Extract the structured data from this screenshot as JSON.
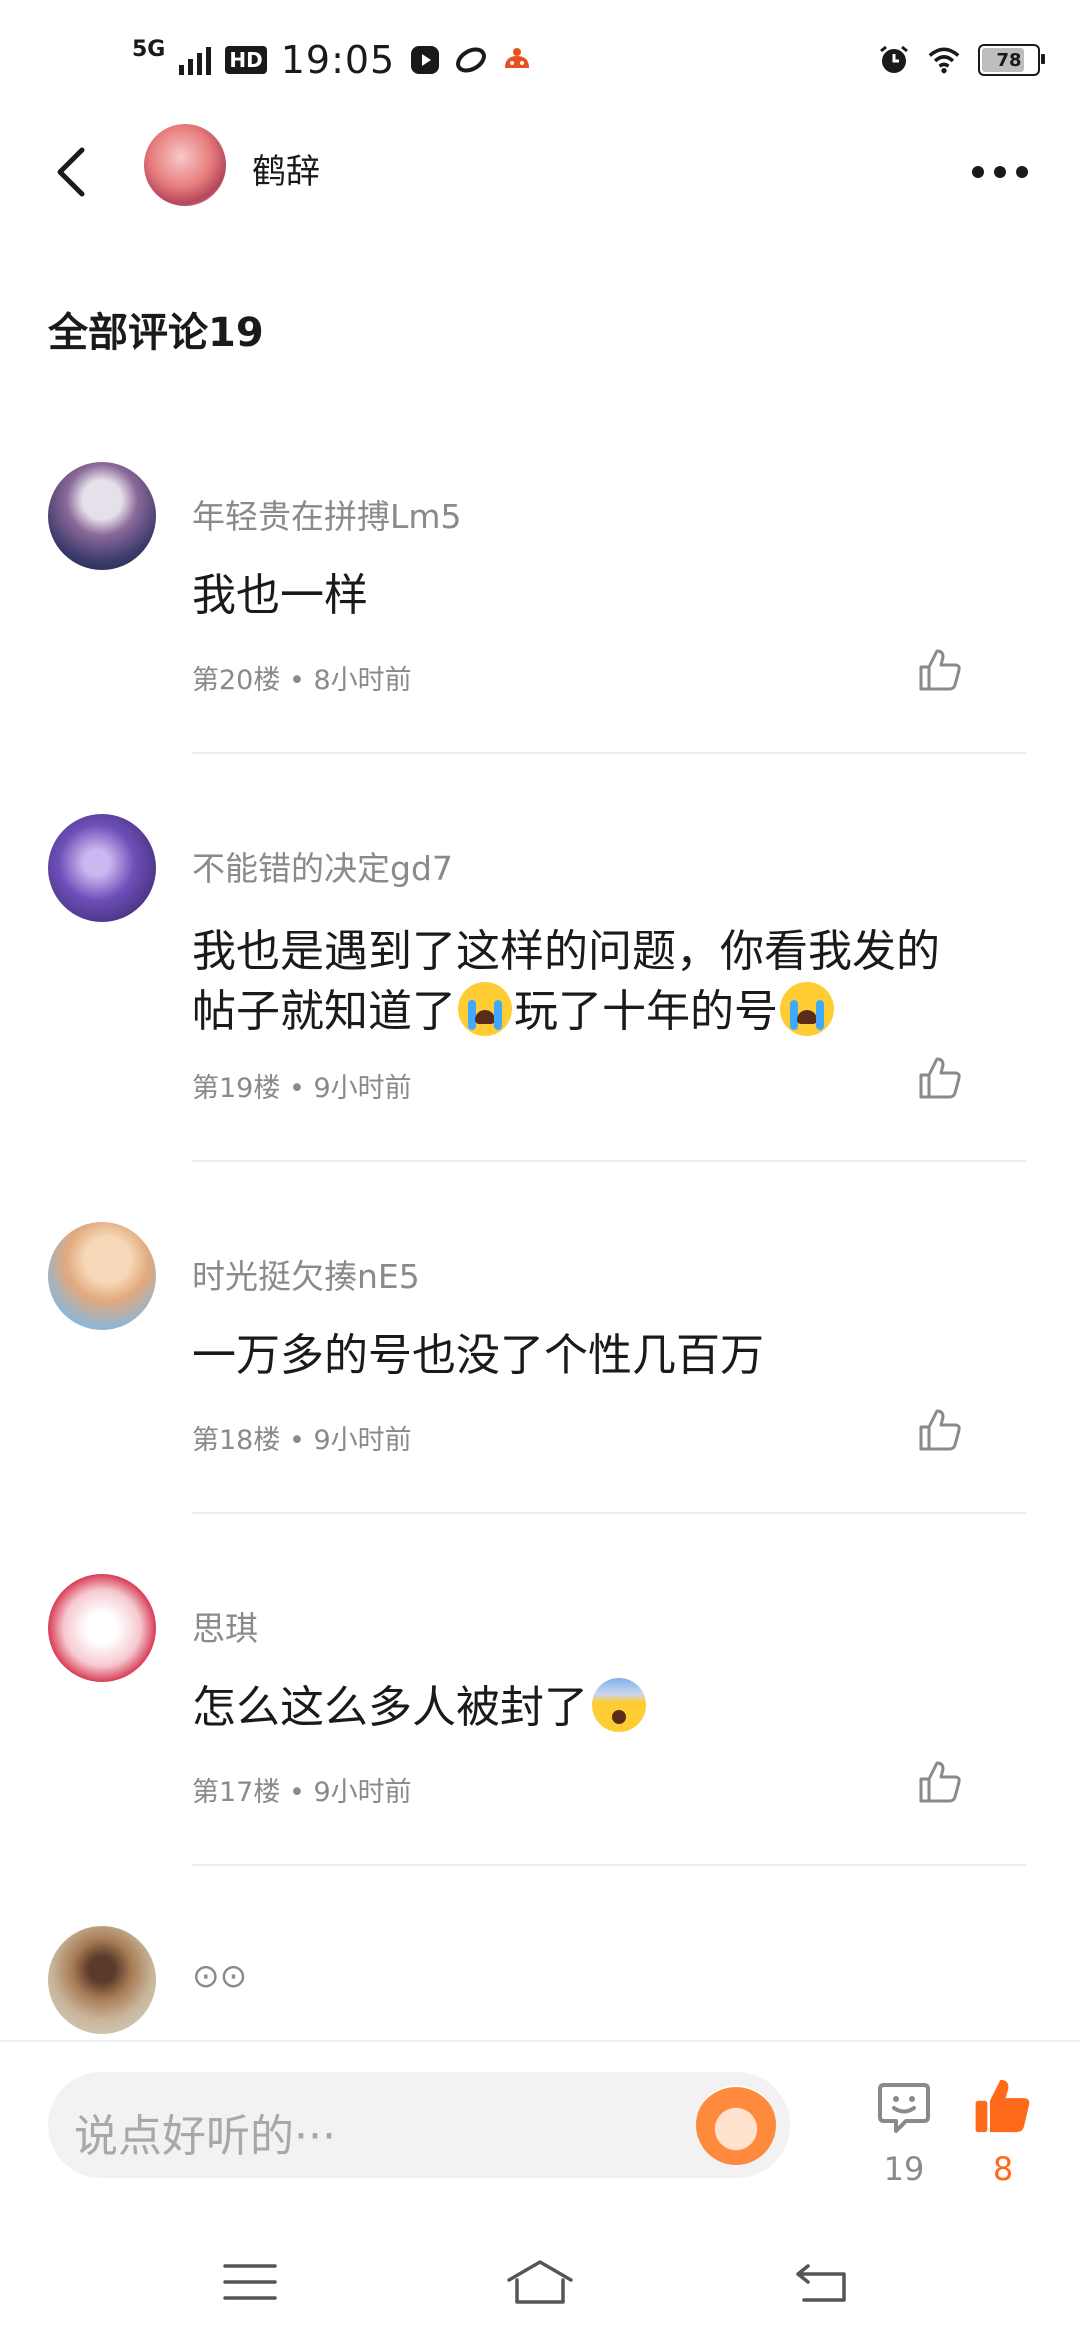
{
  "status_bar": {
    "network": "5G",
    "hd": "HD",
    "time": "19:05",
    "battery": "78",
    "battery_level": 0.78
  },
  "header": {
    "title": "鹤辞"
  },
  "section_title": "全部评论19",
  "comments": [
    {
      "name": "年轻贵在拼搏Lm5",
      "text": "我也一样",
      "floor": "第20楼",
      "time": "8小时前"
    },
    {
      "name": "不能错的决定gd7",
      "text_part1": "我也是遇到了这样的问题，你看我发的帖子就知道了",
      "text_part2": "玩了十年的号",
      "floor": "第19楼",
      "time": "9小时前"
    },
    {
      "name": "时光挺欠揍nE5",
      "text": "一万多的号也没了个性几百万",
      "floor": "第18楼",
      "time": "9小时前"
    },
    {
      "name": "思琪",
      "text": "怎么这么多人被封了",
      "floor": "第17楼",
      "time": "9小时前"
    },
    {
      "name": "⊙⊙"
    }
  ],
  "meta_separator": "•",
  "input": {
    "placeholder": "说点好听的···"
  },
  "actions": {
    "comment_count": "19",
    "like_count": "8"
  },
  "colors": {
    "accent": "#ff6a1a",
    "muted_text": "#8a8a8a"
  },
  "icons": [
    "back-icon",
    "more-icon",
    "thumbs-up-icon",
    "comment-icon",
    "menu-icon",
    "home-icon",
    "return-icon"
  ]
}
